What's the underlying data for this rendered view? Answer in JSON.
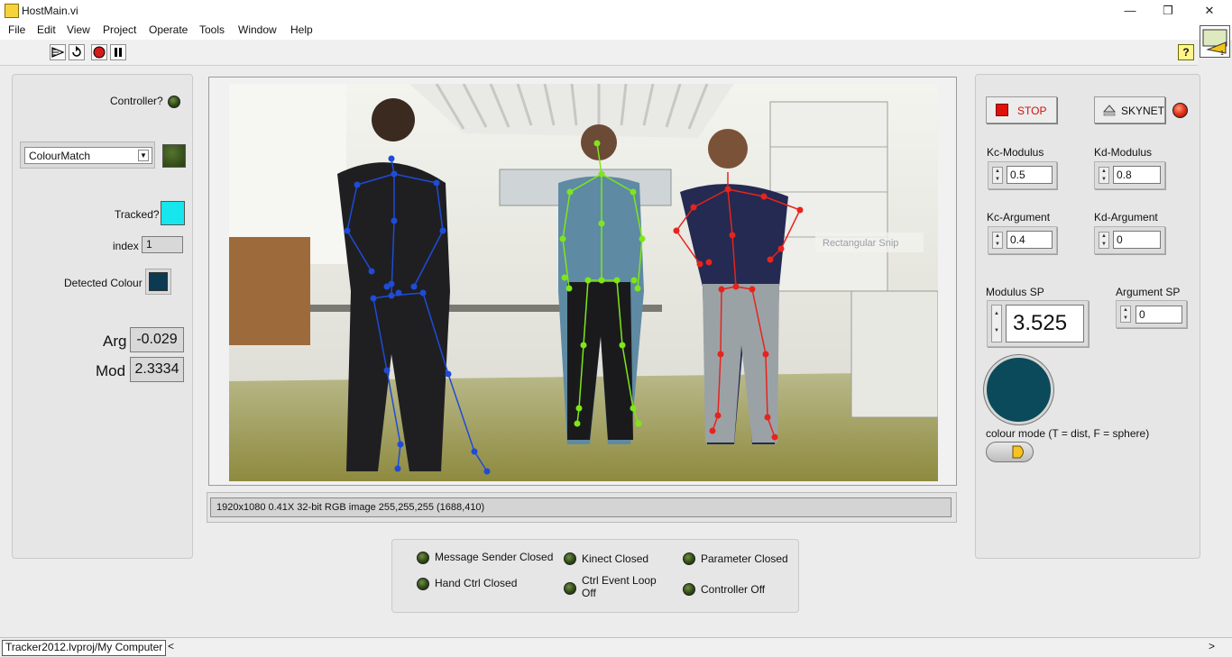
{
  "window": {
    "title": "HostMain.vi",
    "minimize": "—",
    "restore": "❐",
    "close": "✕"
  },
  "menu": [
    "File",
    "Edit",
    "View",
    "Project",
    "Operate",
    "Tools",
    "Window",
    "Help"
  ],
  "toolbar": {
    "help": "?"
  },
  "left": {
    "controller_label": "Controller?",
    "mode_value": "ColourMatch",
    "tracked_label": "Tracked?",
    "index_label": "index",
    "index_value": "1",
    "detected_colour_label": "Detected Colour",
    "arg_label": "Arg",
    "arg_value": "-0.029",
    "mod_label": "Mod",
    "mod_value": "2.3334",
    "tracked_color": "#16e6ee",
    "detected_color": "#0c3a52"
  },
  "image": {
    "status": "1920x1080 0.41X 32-bit RGB image 255,255,255    (1688,410)",
    "snip_text": "Rectangular Snip",
    "skeleton_colors": {
      "left": "#1f4bd6",
      "middle": "#7ee61a",
      "right": "#e6241c"
    }
  },
  "right": {
    "stop_label": "STOP",
    "skynet_label": "SKYNET",
    "kc_modulus_label": "Kc-Modulus",
    "kc_modulus_value": "0.5",
    "kd_modulus_label": "Kd-Modulus",
    "kd_modulus_value": "0.8",
    "kc_argument_label": "Kc-Argument",
    "kc_argument_value": "0.4",
    "kd_argument_label": "Kd-Argument",
    "kd_argument_value": "0",
    "modulus_sp_label": "Modulus SP",
    "modulus_sp_value": "3.525",
    "argument_sp_label": "Argument SP",
    "argument_sp_value": "0",
    "colour_mode_label": "colour mode (T = dist, F = sphere)",
    "colour_swatch": "#0b4a5a"
  },
  "status_leds": {
    "message_sender": "Message Sender Closed",
    "kinect": "Kinect Closed",
    "parameter": "Parameter Closed",
    "hand_ctrl": "Hand Ctrl Closed",
    "ctrl_event_1": "Ctrl Event Loop",
    "ctrl_event_2": "Off",
    "controller_off": "Controller Off"
  },
  "bottom": {
    "project_path": "Tracker2012.lvproj/My Computer"
  }
}
